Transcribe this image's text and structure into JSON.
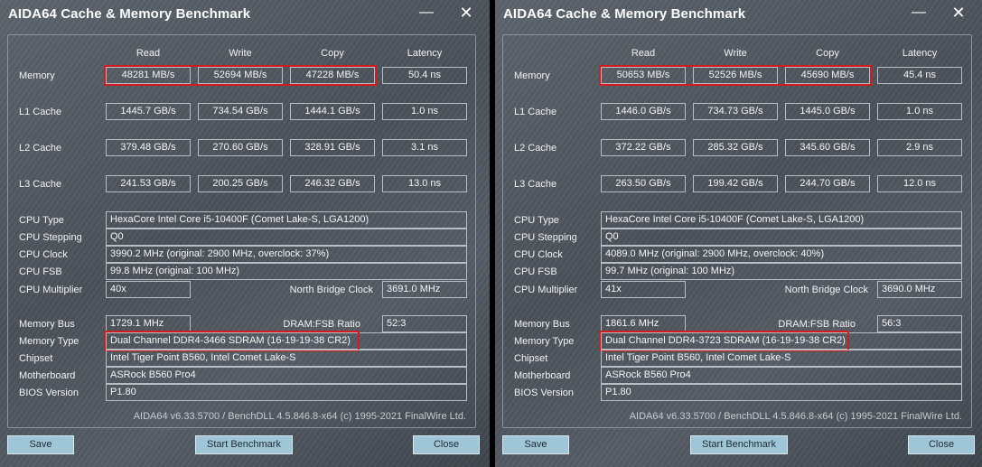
{
  "title": "AIDA64 Cache & Memory Benchmark",
  "minimize_glyph": "—",
  "close_glyph": "✕",
  "headers": {
    "read": "Read",
    "write": "Write",
    "copy": "Copy",
    "latency": "Latency"
  },
  "labels": {
    "memory": "Memory",
    "l1": "L1 Cache",
    "l2": "L2 Cache",
    "l3": "L3 Cache",
    "cpu_type": "CPU Type",
    "cpu_stepping": "CPU Stepping",
    "cpu_clock": "CPU Clock",
    "cpu_fsb": "CPU FSB",
    "cpu_multiplier": "CPU Multiplier",
    "north_bridge_clock": "North Bridge Clock",
    "memory_bus": "Memory Bus",
    "dram_fsb_ratio": "DRAM:FSB Ratio",
    "memory_type": "Memory Type",
    "chipset": "Chipset",
    "motherboard": "Motherboard",
    "bios_version": "BIOS Version"
  },
  "buttons": {
    "save": "Save",
    "start": "Start Benchmark",
    "close": "Close"
  },
  "highlight_color": "#d01c1c",
  "windows": [
    {
      "memory": {
        "read": "48281 MB/s",
        "write": "52694 MB/s",
        "copy": "47228 MB/s",
        "latency": "50.4 ns"
      },
      "l1": {
        "read": "1445.7 GB/s",
        "write": "734.54 GB/s",
        "copy": "1444.1 GB/s",
        "latency": "1.0 ns"
      },
      "l2": {
        "read": "379.48 GB/s",
        "write": "270.60 GB/s",
        "copy": "328.91 GB/s",
        "latency": "3.1 ns"
      },
      "l3": {
        "read": "241.53 GB/s",
        "write": "200.25 GB/s",
        "copy": "246.32 GB/s",
        "latency": "13.0 ns"
      },
      "cpu_type": "HexaCore Intel Core i5-10400F  (Comet Lake-S, LGA1200)",
      "cpu_stepping": "Q0",
      "cpu_clock": "3990.2 MHz  (original: 2900 MHz, overclock: 37%)",
      "cpu_fsb": "99.8 MHz  (original: 100 MHz)",
      "cpu_multiplier": "40x",
      "north_bridge_clock": "3691.0 MHz",
      "memory_bus": "1729.1 MHz",
      "dram_fsb_ratio": "52:3",
      "memory_type": "Dual Channel DDR4-3466 SDRAM  (16-19-19-38 CR2)",
      "chipset": "Intel Tiger Point B560, Intel Comet Lake-S",
      "motherboard": "ASRock B560 Pro4",
      "bios_version": "P1.80",
      "footer": "AIDA64 v6.33.5700 / BenchDLL 4.5.846.8-x64  (c) 1995-2021 FinalWire Ltd."
    },
    {
      "memory": {
        "read": "50653 MB/s",
        "write": "52526 MB/s",
        "copy": "45690 MB/s",
        "latency": "45.4 ns"
      },
      "l1": {
        "read": "1446.0 GB/s",
        "write": "734.73 GB/s",
        "copy": "1445.0 GB/s",
        "latency": "1.0 ns"
      },
      "l2": {
        "read": "372.22 GB/s",
        "write": "285.32 GB/s",
        "copy": "345.60 GB/s",
        "latency": "2.9 ns"
      },
      "l3": {
        "read": "263.50 GB/s",
        "write": "199.42 GB/s",
        "copy": "244.70 GB/s",
        "latency": "12.0 ns"
      },
      "cpu_type": "HexaCore Intel Core i5-10400F  (Comet Lake-S, LGA1200)",
      "cpu_stepping": "Q0",
      "cpu_clock": "4089.0 MHz  (original: 2900 MHz, overclock: 40%)",
      "cpu_fsb": "99.7 MHz  (original: 100 MHz)",
      "cpu_multiplier": "41x",
      "north_bridge_clock": "3690.0 MHz",
      "memory_bus": "1861.6 MHz",
      "dram_fsb_ratio": "56:3",
      "memory_type": "Dual Channel DDR4-3723 SDRAM  (16-19-19-38 CR2)",
      "chipset": "Intel Tiger Point B560, Intel Comet Lake-S",
      "motherboard": "ASRock B560 Pro4",
      "bios_version": "P1.80",
      "footer": "AIDA64 v6.33.5700 / BenchDLL 4.5.846.8-x64  (c) 1995-2021 FinalWire Ltd."
    }
  ]
}
